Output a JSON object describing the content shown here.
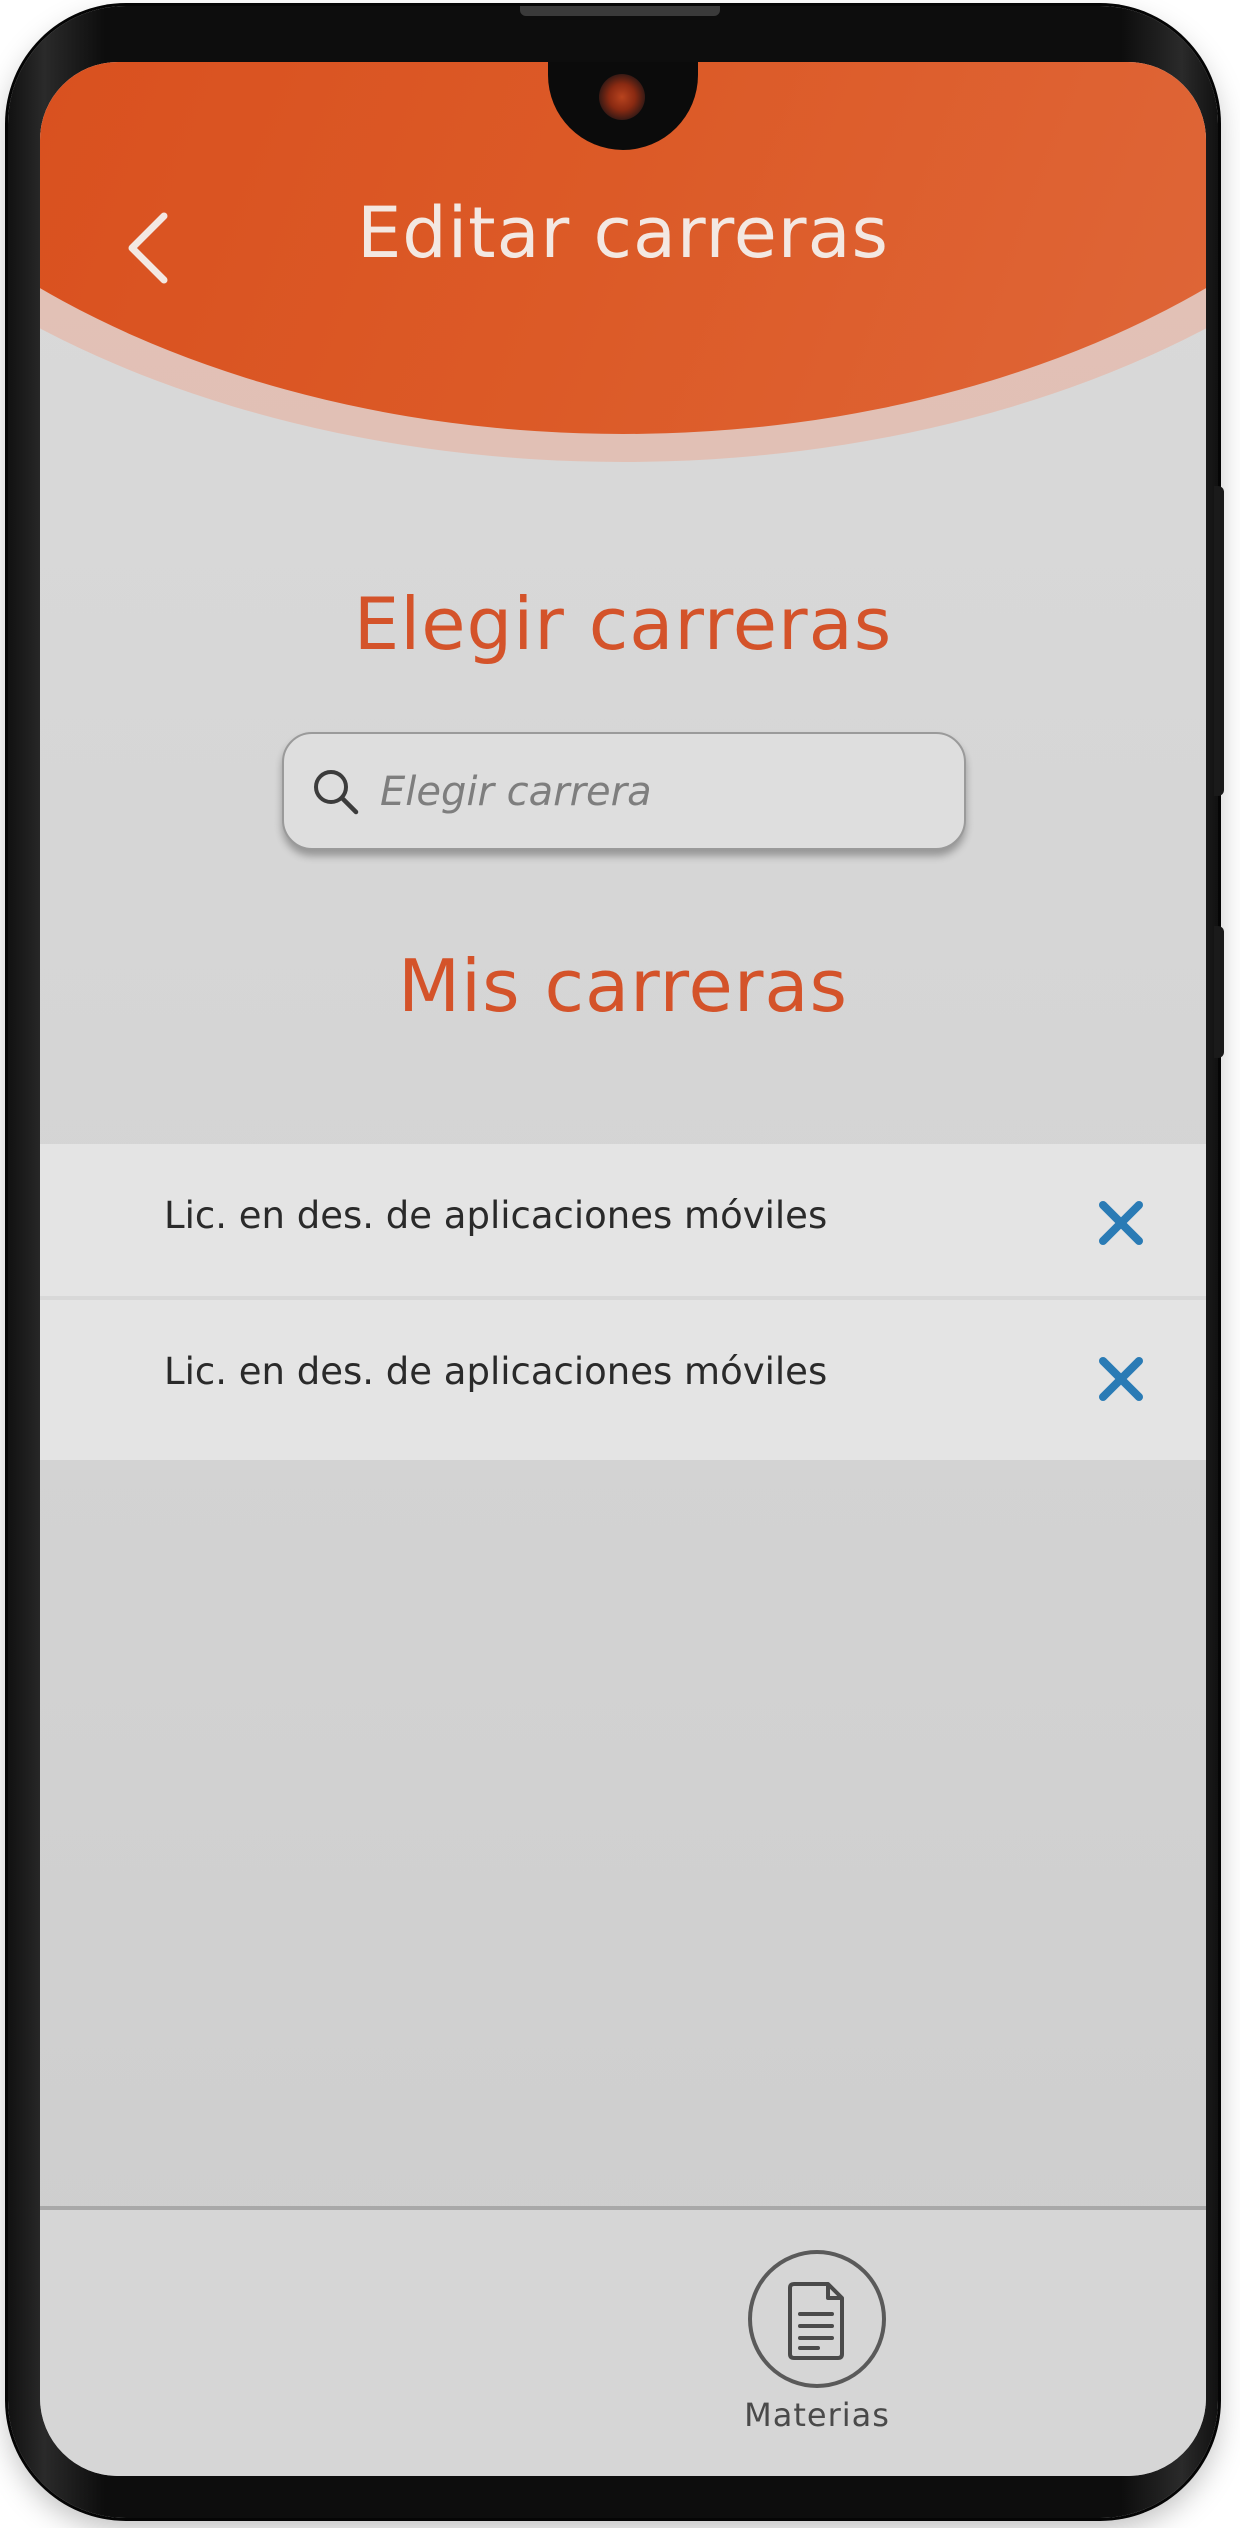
{
  "header": {
    "title": "Editar carreras"
  },
  "choose_section": {
    "title": "Elegir carreras",
    "search": {
      "placeholder": "Elegir carrera",
      "value": ""
    }
  },
  "my_section": {
    "title": "Mis carreras",
    "items": [
      {
        "label": "Lic. en des. de aplicaciones móviles"
      },
      {
        "label": "Lic. en des. de aplicaciones móviles"
      }
    ]
  },
  "bottom_nav": {
    "tabs": [
      {
        "label": "Materias",
        "icon": "document-icon"
      }
    ]
  },
  "colors": {
    "accent": "#D9501F",
    "remove_icon": "#2A7BB5",
    "background": "#D6D6D6"
  }
}
